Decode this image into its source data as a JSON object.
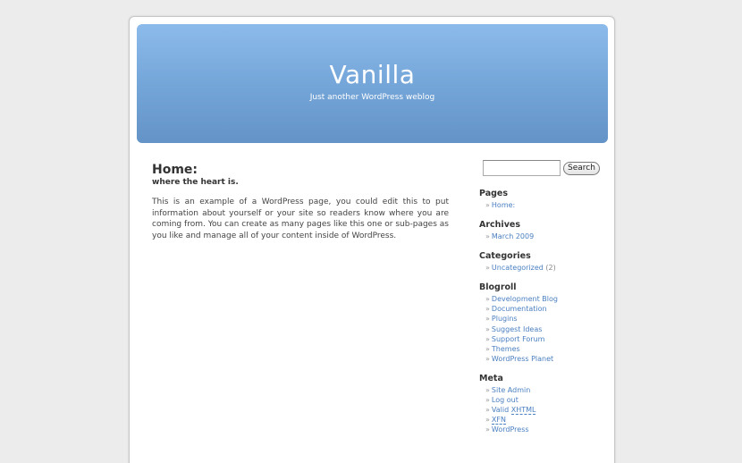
{
  "site": {
    "title": "Vanilla",
    "description": "Just another WordPress weblog"
  },
  "post": {
    "title": "Home:",
    "subtitle": "where the heart is.",
    "body": "This is an example of a WordPress page, you could edit this to put information about yourself or your site so readers know where you are coming from. You can create as many pages like this one or sub-pages as you like and manage all of your content inside of WordPress."
  },
  "search": {
    "value": "",
    "button_label": "Search"
  },
  "sidebar": {
    "bullet": "»",
    "pages": {
      "heading": "Pages",
      "items": [
        {
          "label": "Home:"
        }
      ]
    },
    "archives": {
      "heading": "Archives",
      "items": [
        {
          "label": "March 2009"
        }
      ]
    },
    "categories": {
      "heading": "Categories",
      "items": [
        {
          "label": "Uncategorized",
          "count": "(2)"
        }
      ]
    },
    "blogroll": {
      "heading": "Blogroll",
      "items": [
        {
          "label": "Development Blog"
        },
        {
          "label": "Documentation"
        },
        {
          "label": "Plugins"
        },
        {
          "label": "Suggest Ideas"
        },
        {
          "label": "Support Forum"
        },
        {
          "label": "Themes"
        },
        {
          "label": "WordPress Planet"
        }
      ]
    },
    "meta": {
      "heading": "Meta",
      "items": [
        {
          "label": "Site Admin"
        },
        {
          "label": "Log out"
        },
        {
          "prefix": "Valid ",
          "abbr": "XHTML"
        },
        {
          "abbr": "XFN"
        },
        {
          "label": "WordPress"
        }
      ]
    }
  },
  "colors": {
    "background": "#ececec",
    "header_top": "#8cbbeb",
    "header_bottom": "#6393c7",
    "link": "#4a7fc1"
  }
}
